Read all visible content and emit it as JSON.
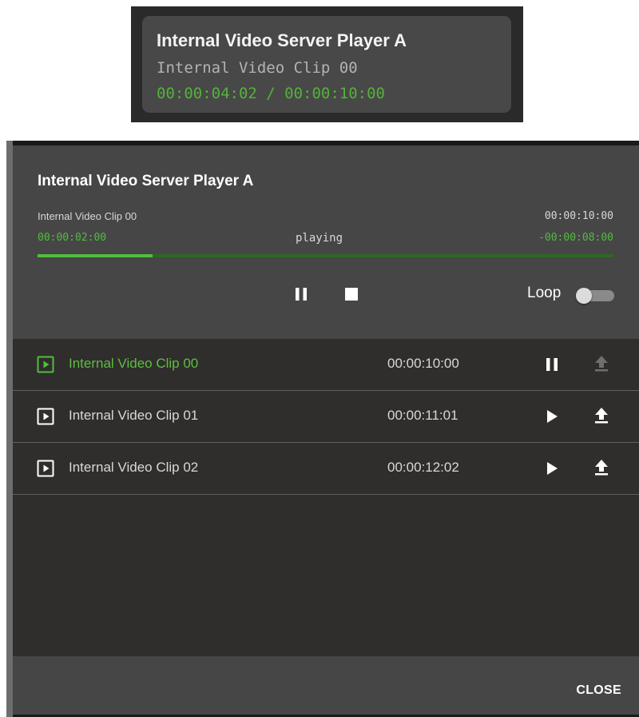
{
  "mini_widget": {
    "title": "Internal Video Server Player A",
    "clip": "Internal Video Clip 00",
    "time": "00:00:04:02 / 00:00:10:00"
  },
  "dialog": {
    "title": "Internal Video Server Player A",
    "current_clip": "Internal Video Clip 00",
    "duration": "00:00:10:00",
    "elapsed": "00:00:02:00",
    "state": "playing",
    "remaining": "-00:00:08:00",
    "progress_fraction": 0.2,
    "loop_label": "Loop",
    "loop_on": false,
    "controls": {
      "pause_icon": "pause-icon",
      "stop_icon": "stop-icon"
    },
    "close_label": "CLOSE"
  },
  "clips": [
    {
      "name": "Internal Video Clip 00",
      "duration": "00:00:10:00",
      "active": true,
      "action_icon": "pause-icon",
      "load_enabled": false
    },
    {
      "name": "Internal Video Clip 01",
      "duration": "00:00:11:01",
      "active": false,
      "action_icon": "play-icon",
      "load_enabled": true
    },
    {
      "name": "Internal Video Clip 02",
      "duration": "00:00:12:02",
      "active": false,
      "action_icon": "play-icon",
      "load_enabled": true
    }
  ],
  "colors": {
    "accent_green": "#4fbe3c",
    "progress_track": "#2c6a22",
    "dialog_bg": "#464646",
    "list_bg": "#302d2d"
  }
}
